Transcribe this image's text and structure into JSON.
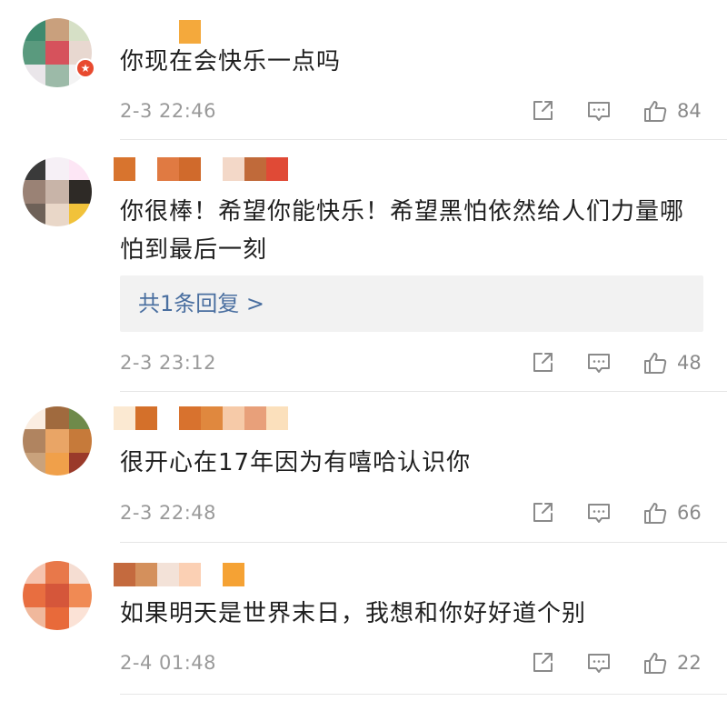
{
  "comments": [
    {
      "text": "你现在会快乐一点吗",
      "timestamp": "2-3 22:46",
      "likes": "84",
      "reply_summary": "",
      "avatar_colors": [
        "#3f8a6e",
        "#c9a07d",
        "#d6e0c6",
        "#5a9a7e",
        "#d6525c",
        "#e8d8d0",
        "#eae6ea",
        "#9cbaa8",
        "#f3f3f3"
      ],
      "name_colors": [
        "#ffffff",
        "#ffffff",
        "#ffffff",
        "#f4a93c"
      ],
      "badge": "★"
    },
    {
      "text": "你很棒！希望你能快乐！希望黑怕依然给人们力量哪怕到最后一刻",
      "timestamp": "2-3 23:12",
      "likes": "48",
      "reply_summary": "共1条回复 >",
      "avatar_colors": [
        "#3a3a3a",
        "#f6f0f6",
        "#fde6f5",
        "#9a8275",
        "#c8b4a8",
        "#2e2a26",
        "#6e6158",
        "#e9d7c8",
        "#f1c23a"
      ],
      "name_colors": [
        "#d8742e",
        "#ffffff",
        "#e07a42",
        "#d06a2c",
        "#ffffff",
        "#f3d8c8",
        "#c06a3a",
        "#e04a36"
      ]
    },
    {
      "text": "很开心在17年因为有嘻哈认识你",
      "timestamp": "2-3 22:48",
      "likes": "66",
      "reply_summary": "",
      "avatar_colors": [
        "#fbeee2",
        "#a06a3e",
        "#6e8a4a",
        "#b08460",
        "#e9a566",
        "#c67a3a",
        "#c9a27c",
        "#f0a04a",
        "#9a3a2a"
      ],
      "name_colors": [
        "#fbe9d2",
        "#d4702a",
        "#ffffff",
        "#d8722e",
        "#e0883e",
        "#f6caa8",
        "#e8a07a",
        "#fbe0bc"
      ]
    },
    {
      "text": "如果明天是世界末日，我想和你好好道个别",
      "timestamp": "2-4 01:48",
      "likes": "22",
      "reply_summary": "",
      "avatar_colors": [
        "#f6c3ae",
        "#e8784a",
        "#f5ddd2",
        "#e86e40",
        "#d5563a",
        "#f08a54",
        "#f0b89c",
        "#e86a3a",
        "#fbe2d6"
      ],
      "name_colors": [
        "#c46a3e",
        "#d4905c",
        "#f3e2d8",
        "#fbd0b4",
        "#ffffff",
        "#f5a234"
      ]
    }
  ],
  "icons": {
    "share": "share-icon",
    "comment": "comment-icon",
    "like": "thumbs-up-icon"
  }
}
